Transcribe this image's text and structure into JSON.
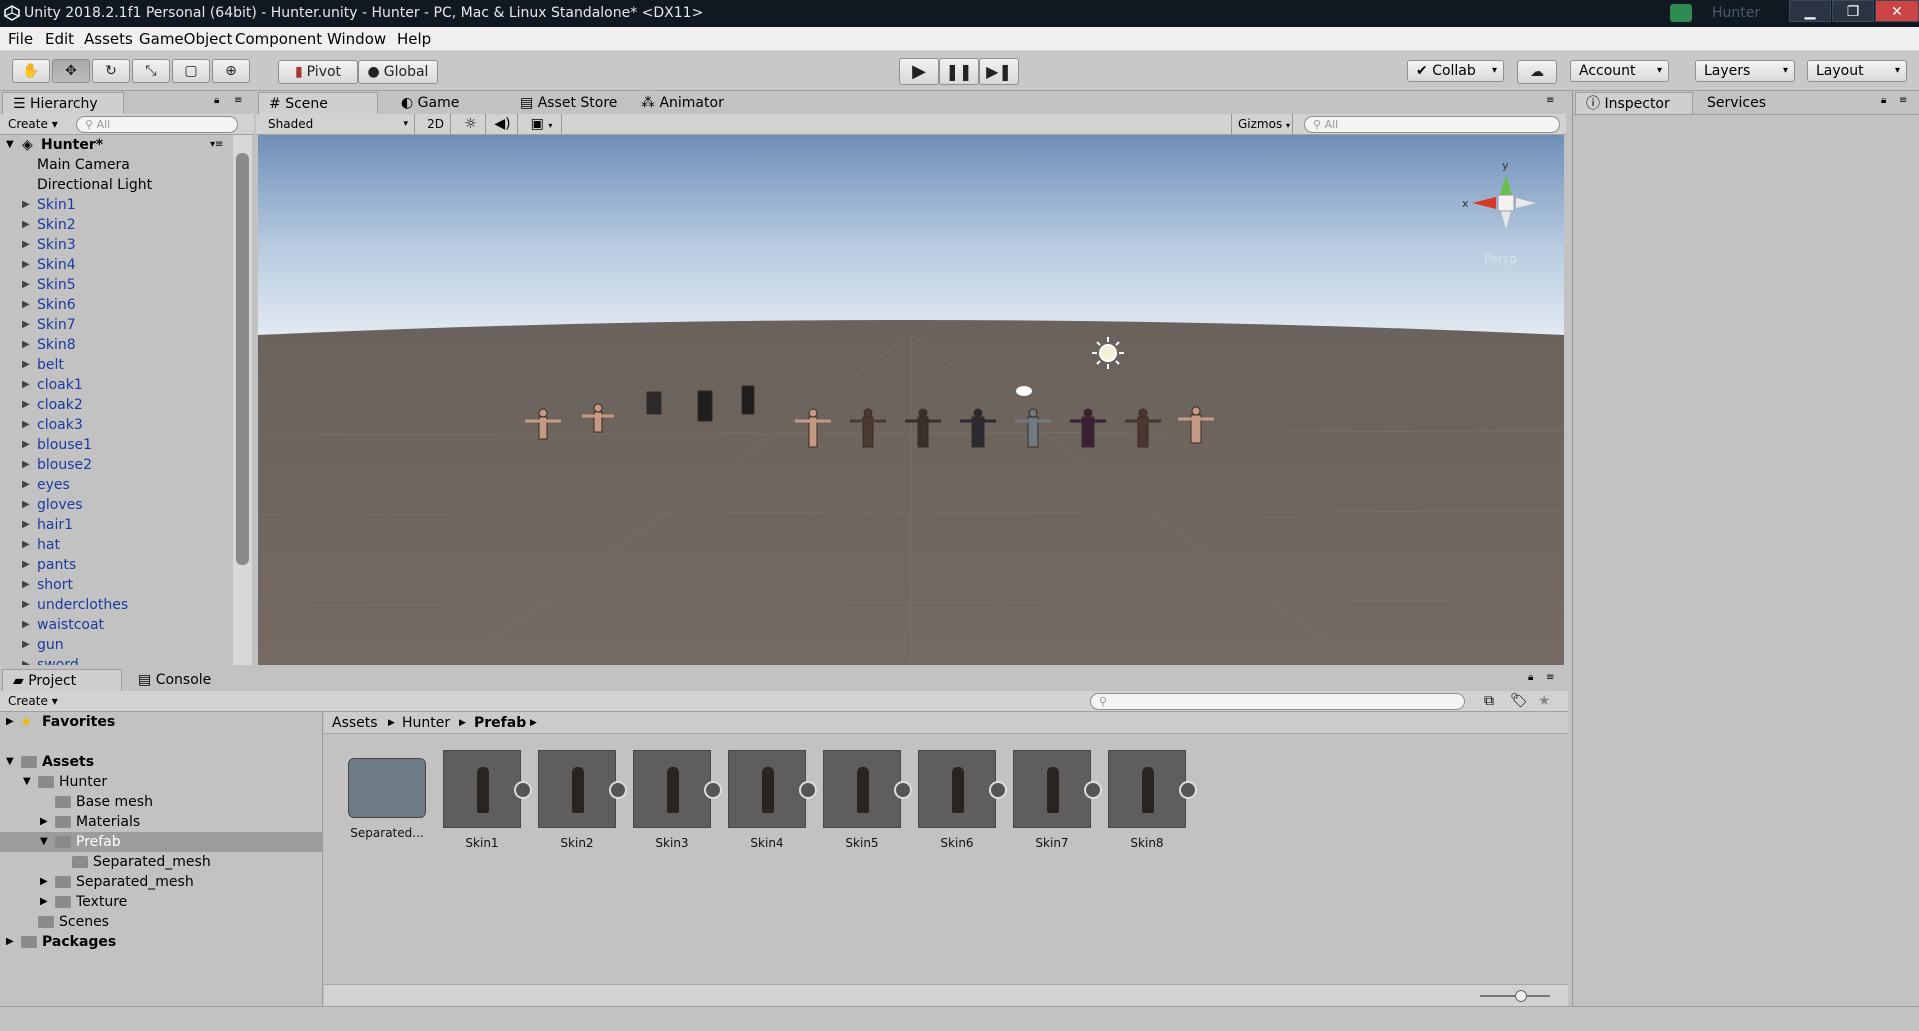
{
  "window": {
    "title": "Unity 2018.2.1f1 Personal (64bit) - Hunter.unity - Hunter - PC, Mac & Linux Standalone* <DX11>",
    "user": "Hunter"
  },
  "menu": [
    "File",
    "Edit",
    "Assets",
    "GameObject",
    "Component",
    "Window",
    "Help"
  ],
  "toolbar": {
    "pivot": "Pivot",
    "global": "Global",
    "collab": "Collab",
    "account": "Account",
    "layers": "Layers",
    "layout": "Layout"
  },
  "hierarchy": {
    "tab": "Hierarchy",
    "create": "Create",
    "search_placeholder": "All",
    "scene": "Hunter*",
    "items": [
      "Main Camera",
      "Directional Light",
      "Skin1",
      "Skin2",
      "Skin3",
      "Skin4",
      "Skin5",
      "Skin6",
      "Skin7",
      "Skin8",
      "belt",
      "cloak1",
      "cloak2",
      "cloak3",
      "blouse1",
      "blouse2",
      "eyes",
      "gloves",
      "hair1",
      "hat",
      "pants",
      "short",
      "underclothes",
      "waistcoat",
      "gun",
      "sword"
    ]
  },
  "scene": {
    "tabs": [
      "Scene",
      "Game",
      "Asset Store",
      "Animator"
    ],
    "shading": "Shaded",
    "mode2d": "2D",
    "gizmos": "Gizmos",
    "search_placeholder": "All",
    "gizmo_x": "x",
    "gizmo_y": "y",
    "persp": "Persp"
  },
  "inspector": {
    "tabs": [
      "Inspector",
      "Services"
    ]
  },
  "project": {
    "tabs": [
      "Project",
      "Console"
    ],
    "create": "Create",
    "favorites": "Favorites",
    "tree": [
      {
        "label": "Assets",
        "depth": 0
      },
      {
        "label": "Hunter",
        "depth": 1
      },
      {
        "label": "Base mesh",
        "depth": 2
      },
      {
        "label": "Materials",
        "depth": 2
      },
      {
        "label": "Prefab",
        "depth": 2
      },
      {
        "label": "Separated_mesh",
        "depth": 3
      },
      {
        "label": "Separated_mesh",
        "depth": 2
      },
      {
        "label": "Texture",
        "depth": 2
      },
      {
        "label": "Scenes",
        "depth": 1
      },
      {
        "label": "Packages",
        "depth": 0
      }
    ],
    "breadcrumb": [
      "Assets",
      "Hunter",
      "Prefab"
    ],
    "assets": [
      "Separated...",
      "Skin1",
      "Skin2",
      "Skin3",
      "Skin4",
      "Skin5",
      "Skin6",
      "Skin7",
      "Skin8"
    ]
  }
}
